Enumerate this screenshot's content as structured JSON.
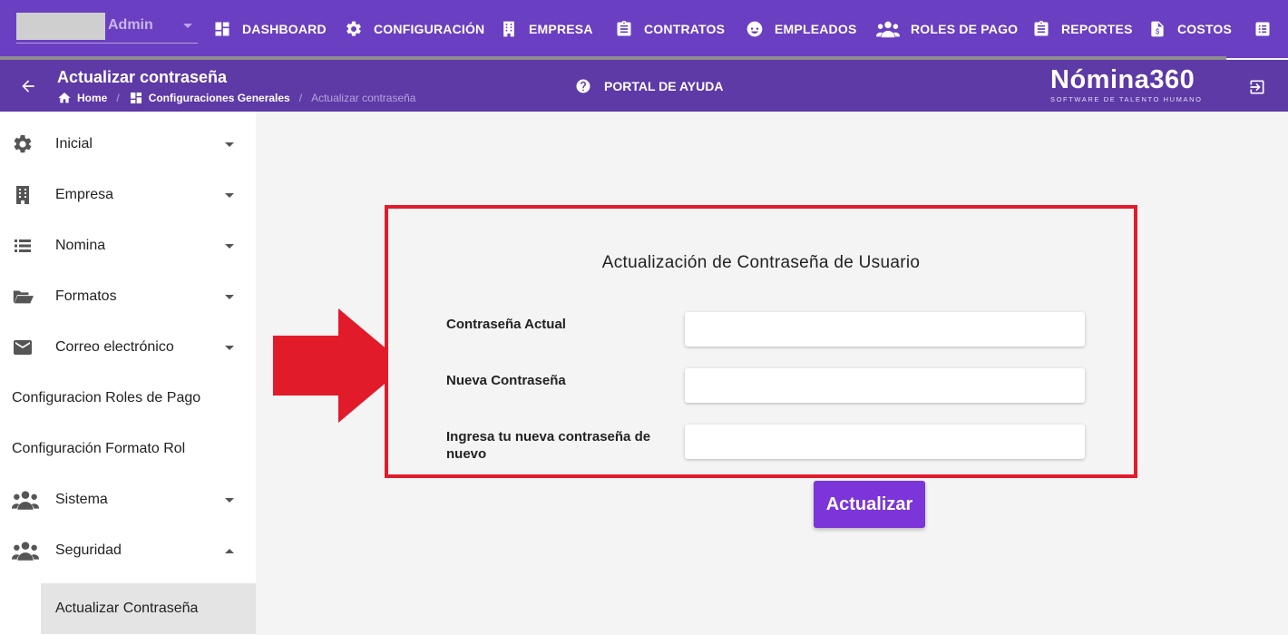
{
  "topbar": {
    "user_name": "Admin",
    "nav": [
      {
        "label": "DASHBOARD",
        "icon": "dashboard-icon"
      },
      {
        "label": "CONFIGURACIÓN",
        "icon": "gear-icon"
      },
      {
        "label": "EMPRESA",
        "icon": "building-icon"
      },
      {
        "label": "CONTRATOS",
        "icon": "clipboard-icon"
      },
      {
        "label": "EMPLEADOS",
        "icon": "face-icon"
      },
      {
        "label": "ROLES DE PAGO",
        "icon": "people-icon"
      },
      {
        "label": "REPORTES",
        "icon": "clipboard-icon"
      },
      {
        "label": "COSTOS",
        "icon": "invoice-icon"
      }
    ],
    "more_icon": "list-box-icon",
    "accent": "#6a3fc1"
  },
  "subheader": {
    "title": "Actualizar contraseña",
    "breadcrumb": {
      "home": "Home",
      "section": "Configuraciones Generales",
      "current": "Actualizar contraseña"
    },
    "help_label": "PORTAL DE AYUDA",
    "brand_logo": "Nómina360",
    "brand_tagline": "SOFTWARE DE TALENTO HUMANO"
  },
  "sidebar": {
    "items": [
      {
        "label": "Inicial",
        "icon": "gear-icon"
      },
      {
        "label": "Empresa",
        "icon": "building-icon"
      },
      {
        "label": "Nomina",
        "icon": "list-icon"
      },
      {
        "label": "Formatos",
        "icon": "folder-open-icon"
      },
      {
        "label": "Correo electrónico",
        "icon": "mail-icon"
      },
      {
        "label": "Configuracion Roles de Pago"
      },
      {
        "label": "Configuración Formato Rol"
      },
      {
        "label": "Sistema",
        "icon": "people-icon"
      },
      {
        "label": "Seguridad",
        "icon": "people-icon"
      }
    ],
    "active_sub": "Actualizar Contraseña"
  },
  "form": {
    "title": "Actualización de Contraseña de Usuario",
    "current_password_label": "Contraseña Actual",
    "new_password_label": "Nueva Contraseña",
    "confirm_password_label": "Ingresa tu nueva contraseña de nuevo",
    "current_password_value": "",
    "new_password_value": "",
    "confirm_password_value": "",
    "submit_label": "Actualizar",
    "highlight_color": "#e21b2a",
    "button_color": "#7b35d8"
  }
}
